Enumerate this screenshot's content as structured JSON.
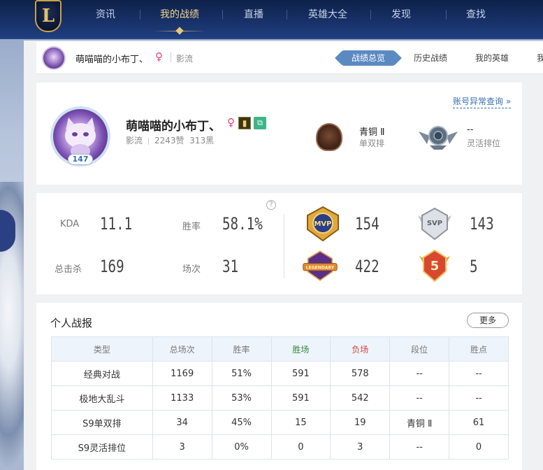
{
  "nav": {
    "logo": "L",
    "items": [
      "资讯",
      "我的战绩",
      "直播",
      "英雄大全",
      "发现",
      "查找"
    ],
    "active_index": 1
  },
  "subbar": {
    "name": "萌喵喵的小布丁、",
    "gender_symbol": "♀",
    "server": "影流",
    "tabs": [
      "战绩总览",
      "历史战绩",
      "我的英雄"
    ],
    "tab_overflow": "我"
  },
  "profile": {
    "account_link": "账号异常查询 »",
    "name": "萌喵喵的小布丁、",
    "gender_symbol": "♀",
    "level": "147",
    "server": "影流",
    "likes": "2243赞",
    "dislikes": "313黑",
    "solo_rank": {
      "tier": "青铜 Ⅱ",
      "queue": "单双排"
    },
    "flex_rank": {
      "tier": "--",
      "queue": "灵活排位"
    }
  },
  "stats": {
    "kda_label": "KDA",
    "kda": "11.1",
    "winrate_label": "胜率",
    "winrate": "58.1%",
    "kills_label": "总击杀",
    "kills": "169",
    "games_label": "场次",
    "games": "31",
    "help": "?",
    "medals": [
      {
        "name": "MVP",
        "count": "154",
        "color": "#e0a93a"
      },
      {
        "name": "SVP",
        "count": "143",
        "color": "#c8ccd4"
      },
      {
        "name": "LEGENDARY",
        "count": "422",
        "color": "#e08a2e"
      },
      {
        "name": "5",
        "count": "5",
        "color": "#d9472e"
      }
    ]
  },
  "report": {
    "title": "个人战报",
    "more": "更多",
    "headers": [
      "类型",
      "总场次",
      "胜率",
      "胜场",
      "负场",
      "段位",
      "胜点"
    ],
    "rows": [
      [
        "经典对战",
        "1169",
        "51%",
        "591",
        "578",
        "--",
        "--"
      ],
      [
        "极地大乱斗",
        "1133",
        "53%",
        "591",
        "542",
        "--",
        "--"
      ],
      [
        "S9单双排",
        "34",
        "45%",
        "15",
        "19",
        "青铜 Ⅱ",
        "61"
      ],
      [
        "S9灵活排位",
        "3",
        "0%",
        "0",
        "3",
        "--",
        "0"
      ]
    ]
  }
}
